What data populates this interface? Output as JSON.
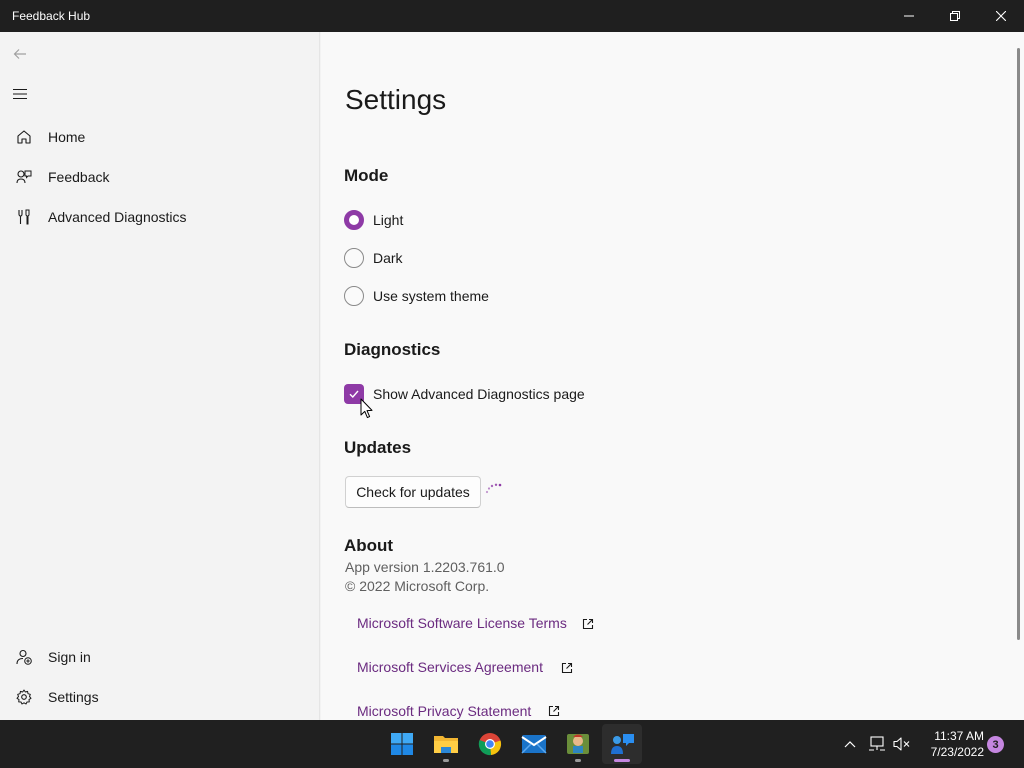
{
  "window": {
    "title": "Feedback Hub"
  },
  "nav": {
    "items": [
      {
        "label": "Home",
        "icon": "home-icon"
      },
      {
        "label": "Feedback",
        "icon": "feedback-icon"
      },
      {
        "label": "Advanced Diagnostics",
        "icon": "tools-icon"
      }
    ],
    "footer": [
      {
        "label": "Sign in",
        "icon": "person-add-icon"
      },
      {
        "label": "Settings",
        "icon": "gear-icon"
      }
    ]
  },
  "settings": {
    "title": "Settings",
    "mode": {
      "heading": "Mode",
      "options": [
        {
          "label": "Light",
          "selected": true
        },
        {
          "label": "Dark",
          "selected": false
        },
        {
          "label": "Use system theme",
          "selected": false
        }
      ]
    },
    "diagnostics": {
      "heading": "Diagnostics",
      "checkbox_label": "Show Advanced Diagnostics page",
      "checked": true
    },
    "updates": {
      "heading": "Updates",
      "button_label": "Check for updates",
      "loading": true
    },
    "about": {
      "heading": "About",
      "version": "App version 1.2203.761.0",
      "copyright": "© 2022 Microsoft Corp.",
      "links": [
        "Microsoft Software License Terms",
        "Microsoft Services Agreement",
        "Microsoft Privacy Statement"
      ]
    }
  },
  "taskbar": {
    "apps": [
      "start",
      "file-explorer",
      "chrome",
      "mail",
      "game",
      "feedback-hub"
    ],
    "active_app": "feedback-hub",
    "time": "11:37 AM",
    "date": "7/23/2022",
    "notification_count": "3"
  },
  "colors": {
    "accent": "#8e3aa6",
    "link": "#6b2b80",
    "titlebar": "#1f1f1f",
    "taskbar": "#202020"
  }
}
